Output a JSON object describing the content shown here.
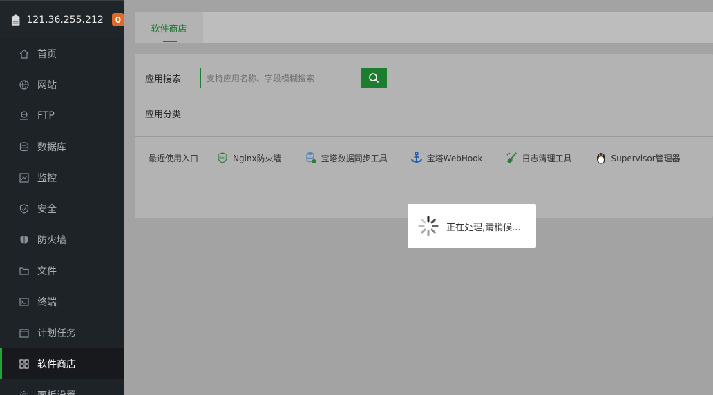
{
  "server": {
    "ip": "121.36.255.212",
    "badge_count": "0"
  },
  "sidebar": {
    "items": [
      {
        "label": "首页",
        "icon": "home-icon"
      },
      {
        "label": "网站",
        "icon": "globe-icon"
      },
      {
        "label": "FTP",
        "icon": "ftp-icon"
      },
      {
        "label": "数据库",
        "icon": "database-icon"
      },
      {
        "label": "监控",
        "icon": "monitor-icon"
      },
      {
        "label": "安全",
        "icon": "shield-icon"
      },
      {
        "label": "防火墙",
        "icon": "firewall-icon"
      },
      {
        "label": "文件",
        "icon": "folder-icon"
      },
      {
        "label": "终端",
        "icon": "terminal-icon"
      },
      {
        "label": "计划任务",
        "icon": "calendar-icon"
      },
      {
        "label": "软件商店",
        "icon": "grid-icon",
        "active": true
      },
      {
        "label": "面板设置",
        "icon": "gear-icon"
      }
    ]
  },
  "tabs": {
    "active_label": "软件商店"
  },
  "search": {
    "label": "应用搜索",
    "placeholder": "支持应用名称、字段模糊搜索"
  },
  "category": {
    "label": "应用分类"
  },
  "recent": {
    "label": "最近使用入口",
    "plugins": [
      {
        "name": "Nginx防火墙",
        "icon": "waf-icon"
      },
      {
        "name": "宝塔数据同步工具",
        "icon": "database-sync-icon"
      },
      {
        "name": "宝塔WebHook",
        "icon": "anchor-icon"
      },
      {
        "name": "日志清理工具",
        "icon": "broom-icon"
      },
      {
        "name": "Supervisor管理器",
        "icon": "penguin-icon"
      }
    ]
  },
  "loading": {
    "text": "正在处理,请稍候..."
  },
  "colors": {
    "accent": "#20a53a",
    "sidebar_bg": "#1e2328",
    "badge": "#e06a2a"
  }
}
